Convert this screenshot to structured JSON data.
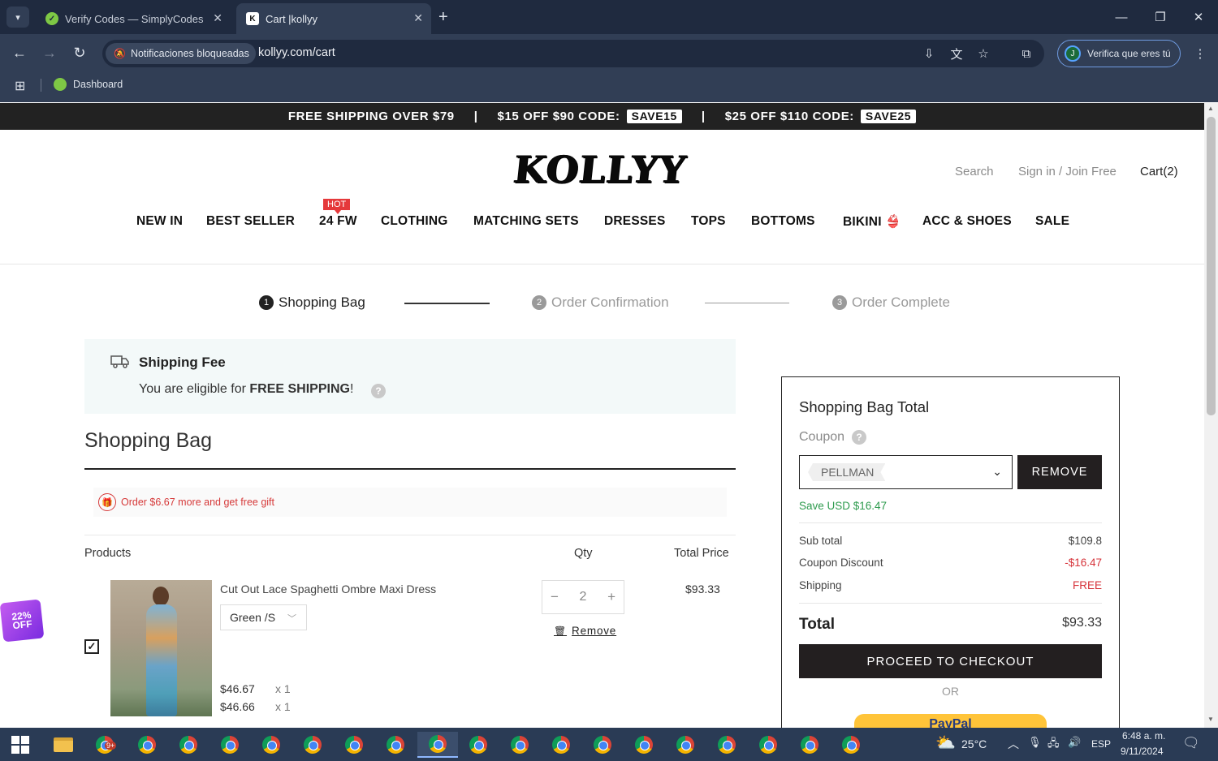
{
  "browser": {
    "tabs": [
      {
        "label": "Verify Codes — SimplyCodes",
        "icon": "simplycodes-icon"
      },
      {
        "label": "Cart |kollyy",
        "icon": "kollyy-icon"
      }
    ],
    "chip": "Notificaciones bloqueadas",
    "url": "kollyy.com/cart",
    "profile_label": "Verifica que eres tú",
    "profile_initial": "J",
    "bookmark": "Dashboard"
  },
  "promo": {
    "part1": "FREE SHIPPING OVER $79",
    "part2": "$15 OFF $90  CODE:",
    "code1": "SAVE15",
    "part3": "$25 OFF $110  CODE:",
    "code2": "SAVE25",
    "sep": "|"
  },
  "header": {
    "logo": "KOLLYY",
    "search": "Search",
    "signin": "Sign in / Join Free",
    "cart": "Cart(2)"
  },
  "nav": {
    "items": [
      "NEW IN",
      "BEST SELLER",
      "24 FW",
      "CLOTHING",
      "MATCHING SETS",
      "DRESSES",
      "TOPS",
      "BOTTOMS",
      "BIKINI 👙",
      "ACC & SHOES",
      "SALE"
    ],
    "hot_badge": "HOT"
  },
  "steps": [
    {
      "num": "1",
      "label": "Shopping Bag"
    },
    {
      "num": "2",
      "label": "Order Confirmation"
    },
    {
      "num": "3",
      "label": "Order Complete"
    }
  ],
  "shipping": {
    "title": "Shipping Fee",
    "text_prefix": "You are eligible for ",
    "text_bold": "FREE SHIPPING",
    "text_suffix": "!",
    "help": "?"
  },
  "bag": {
    "title": "Shopping Bag",
    "gift_msg": "Order $6.67 more and get free gift",
    "columns": {
      "products": "Products",
      "qty": "Qty",
      "total": "Total Price"
    },
    "item": {
      "name": "Cut Out Lace Spaghetti Ombre Maxi Dress",
      "variant": "Green /S",
      "qty": "2",
      "minus": "−",
      "plus": "+",
      "remove": "Remove",
      "total": "$93.33",
      "price_lines": [
        {
          "price": "$46.67",
          "qty": "x 1"
        },
        {
          "price": "$46.66",
          "qty": "x 1"
        }
      ],
      "checked": true
    }
  },
  "summary": {
    "title": "Shopping Bag Total",
    "coupon_label": "Coupon",
    "coupon_help": "?",
    "coupon_code": "PELLMAN",
    "remove_btn": "REMOVE",
    "save_text": "Save USD $16.47",
    "rows": [
      {
        "label": "Sub total",
        "value": "$109.8"
      },
      {
        "label": "Coupon Discount",
        "value": "-$16.47"
      },
      {
        "label": "Shipping",
        "value": "FREE"
      }
    ],
    "total_label": "Total",
    "total_value": "$93.33",
    "checkout_btn": "PROCEED TO CHECKOUT",
    "or": "OR",
    "paypal": "PayPal"
  },
  "floating_badge": "22% OFF",
  "taskbar": {
    "weather": "25°C",
    "lang": "ESP",
    "time": "6:48 a. m.",
    "date": "9/11/2024",
    "notif_badge": "9+"
  }
}
